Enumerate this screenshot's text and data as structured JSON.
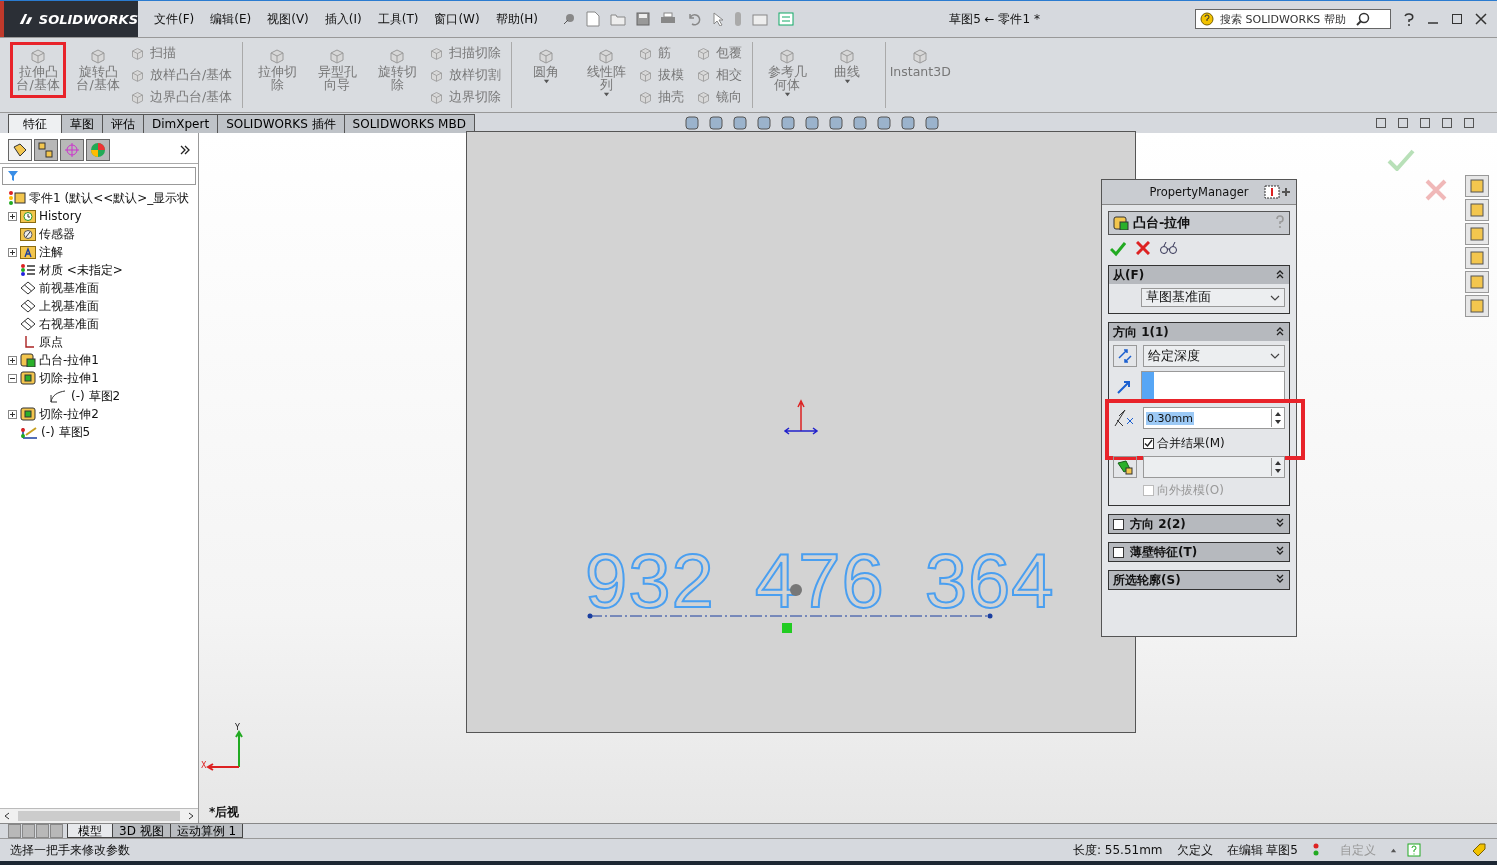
{
  "logo": "SOLIDWORKS",
  "menu": [
    "文件(F)",
    "编辑(E)",
    "视图(V)",
    "插入(I)",
    "工具(T)",
    "窗口(W)",
    "帮助(H)"
  ],
  "title": "草图5 ← 零件1 *",
  "search": {
    "placeholder": "搜索 SOLIDWORKS 帮助"
  },
  "ribbon": [
    {
      "large": [
        {
          "label": "拉伸凸台/基体",
          "highlighted": true,
          "dropdown": false
        },
        {
          "label": "旋转凸台/基体",
          "highlighted": false,
          "dropdown": false
        }
      ],
      "small": [
        "扫描",
        "放样凸台/基体",
        "边界凸台/基体"
      ]
    },
    {
      "large": [
        {
          "label": "拉伸切除",
          "highlighted": false,
          "dropdown": false
        },
        {
          "label": "异型孔向导",
          "highlighted": false,
          "dropdown": false
        },
        {
          "label": "旋转切除",
          "highlighted": false,
          "dropdown": false
        }
      ],
      "small": [
        "扫描切除",
        "放样切割",
        "边界切除"
      ]
    },
    {
      "large": [
        {
          "label": "圆角",
          "highlighted": false,
          "dropdown": true
        },
        {
          "label": "线性阵列",
          "highlighted": false,
          "dropdown": true
        }
      ],
      "small": [
        "筋",
        "拔模",
        "抽壳",
        "包覆",
        "相交",
        "镜向"
      ]
    },
    {
      "large": [
        {
          "label": "参考几何体",
          "highlighted": false,
          "dropdown": true
        },
        {
          "label": "曲线",
          "highlighted": false,
          "dropdown": true
        }
      ]
    },
    {
      "large": [
        {
          "label": "Instant3D",
          "highlighted": false,
          "dropdown": false
        }
      ]
    }
  ],
  "tabs": [
    {
      "label": "特征",
      "selected": true
    },
    {
      "label": "草图",
      "selected": false
    },
    {
      "label": "评估",
      "selected": false
    },
    {
      "label": "DimXpert",
      "selected": false
    },
    {
      "label": "SOLIDWORKS 插件",
      "selected": false
    },
    {
      "label": "SOLIDWORKS MBD",
      "selected": false
    }
  ],
  "tree": {
    "root": "零件1  (默认<<默认>_显示状",
    "items": [
      {
        "label": "History",
        "kind": "history",
        "expanded": false
      },
      {
        "label": "传感器",
        "kind": "sensor"
      },
      {
        "label": "注解",
        "kind": "annotation",
        "expanded": false
      },
      {
        "label": "材质 <未指定>",
        "kind": "material"
      },
      {
        "label": "前视基准面",
        "kind": "plane"
      },
      {
        "label": "上视基准面",
        "kind": "plane"
      },
      {
        "label": "右视基准面",
        "kind": "plane"
      },
      {
        "label": "原点",
        "kind": "origin"
      },
      {
        "label": "凸台-拉伸1",
        "kind": "boss",
        "expanded": false
      },
      {
        "label": "切除-拉伸1",
        "kind": "cut",
        "expanded": true,
        "children": [
          {
            "label": "(-) 草图2",
            "kind": "sketch"
          }
        ]
      },
      {
        "label": "切除-拉伸2",
        "kind": "cut",
        "expanded": false
      },
      {
        "label": "(-) 草图5",
        "kind": "active-sketch"
      }
    ]
  },
  "pm": {
    "title": "PropertyManager",
    "feature": "凸台-拉伸",
    "sections": [
      {
        "kind": "from",
        "title": "从(F)",
        "expanded": true,
        "select": "草图基准面"
      },
      {
        "kind": "direction",
        "title": "方向 1(1)",
        "expanded": true,
        "select": "给定深度",
        "depth": "0.30mm",
        "highlighted": true,
        "options": [
          {
            "label": "合并结果(M)",
            "checked": true,
            "disabled": false
          },
          {
            "label": "向外拔模(O)",
            "checked": false,
            "disabled": true
          }
        ]
      },
      {
        "kind": "optional",
        "title": "方向 2(2)",
        "expanded": false,
        "checked": false
      },
      {
        "kind": "optional",
        "title": "薄壁特征(T)",
        "expanded": false,
        "checked": false
      },
      {
        "kind": "plain",
        "title": "所选轮廓(S)",
        "expanded": false
      }
    ]
  },
  "viewport": {
    "view_name": "*后视",
    "sketch_text": "932 476 364",
    "axis_y": "Y",
    "axis_x": "X"
  },
  "bottom_tabs": [
    {
      "label": "模型",
      "selected": true
    },
    {
      "label": "3D 视图",
      "selected": false
    },
    {
      "label": "运动算例 1",
      "selected": false
    }
  ],
  "status": {
    "message": "选择一把手来修改参数",
    "length": "长度: 55.51mm",
    "definition": "欠定义",
    "editing": "在编辑 草图5",
    "custom": "自定义"
  }
}
